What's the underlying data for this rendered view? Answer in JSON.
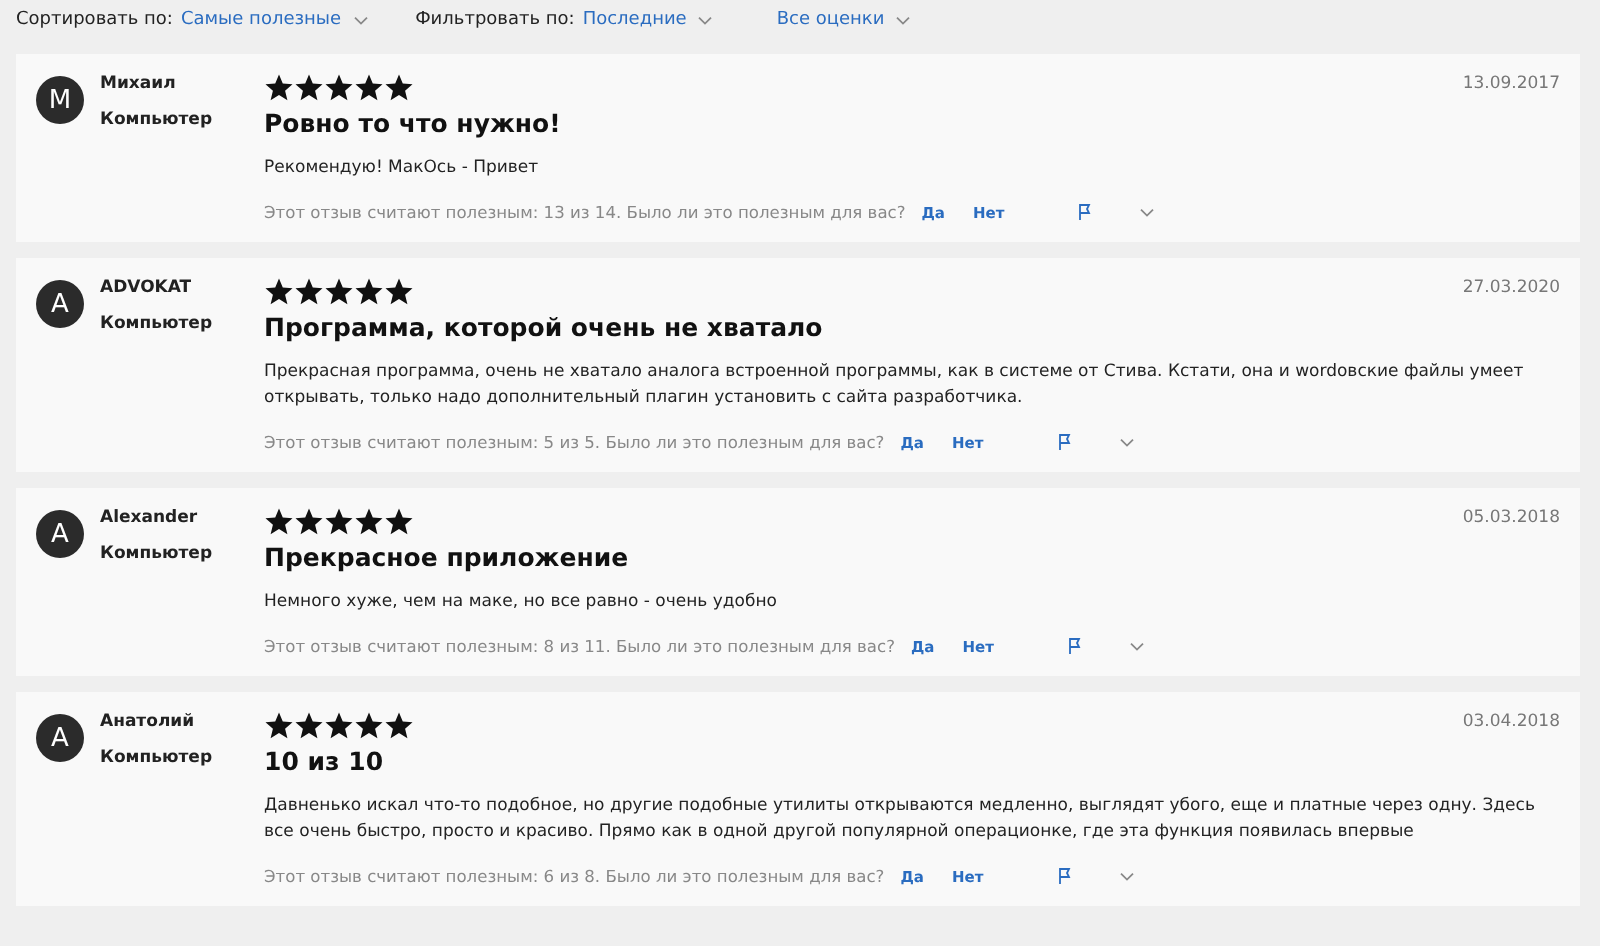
{
  "toolbar": {
    "sort": {
      "label": "Сортировать по:",
      "value": "Самые полезные"
    },
    "filter": {
      "label": "Фильтровать по:",
      "value": "Последние"
    },
    "rating_filter": {
      "value": "Все оценки"
    }
  },
  "reviews": [
    {
      "avatar": "М",
      "name": "Михаил",
      "device": "Компьютер",
      "stars": 5,
      "title": "Ровно то что нужно!",
      "body": "Рекомендую! МакОсь - Привет",
      "date": "13.09.2017",
      "helpful": "Этот отзыв считают полезным: 13 из 14. Было ли это полезным для вас?",
      "yes": "Да",
      "no": "Нет"
    },
    {
      "avatar": "A",
      "name": "ADVOKAT",
      "device": "Компьютер",
      "stars": 5,
      "title": "Программа, которой очень не хватало",
      "body": "Прекрасная программа, очень не хватало аналога встроенной программы, как в системе от Стива. Кстати, она и wordовские файлы умеет открывать, только надо дополнительный плагин установить с сайта разработчика.",
      "date": "27.03.2020",
      "helpful": "Этот отзыв считают полезным: 5 из 5. Было ли это полезным для вас?",
      "yes": "Да",
      "no": "Нет"
    },
    {
      "avatar": "A",
      "name": "Alexander",
      "device": "Компьютер",
      "stars": 5,
      "title": "Прекрасное приложение",
      "body": "Немного хуже, чем на маке, но все равно - очень удобно",
      "date": "05.03.2018",
      "helpful": "Этот отзыв считают полезным: 8 из 11. Было ли это полезным для вас?",
      "yes": "Да",
      "no": "Нет"
    },
    {
      "avatar": "A",
      "name": "Анатолий",
      "device": "Компьютер",
      "stars": 5,
      "title": "10 из 10",
      "body": "Давненько искал что-то подобное, но другие подобные утилиты открываются медленно, выглядят убого, еще и платные через одну. Здесь все очень быстро, просто и красиво. Прямо как в одной другой популярной операционке, где эта функция появилась впервые",
      "date": "03.04.2018",
      "helpful": "Этот отзыв считают полезным: 6 из 8. Было ли это полезным для вас?",
      "yes": "Да",
      "no": "Нет"
    }
  ]
}
